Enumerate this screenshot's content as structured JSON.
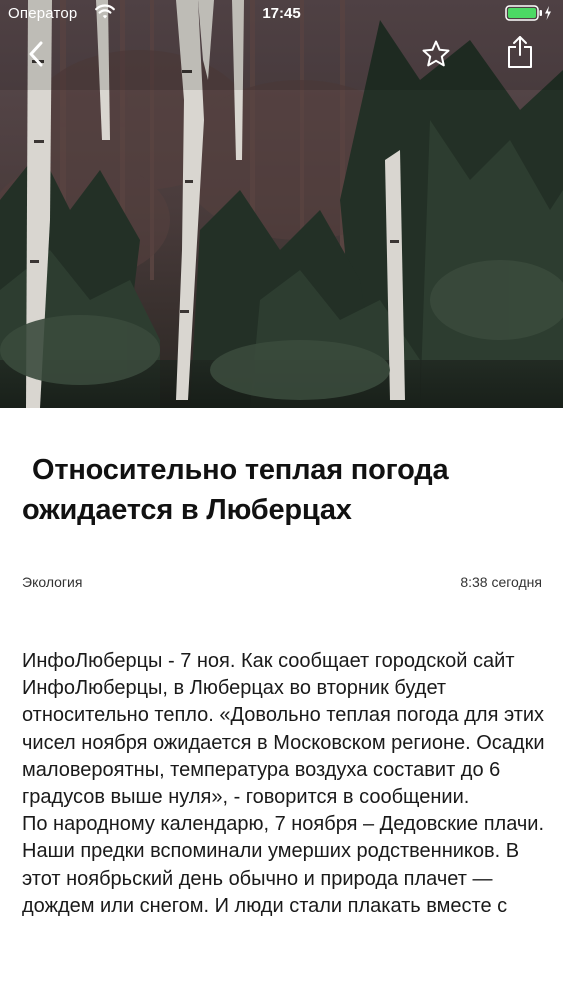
{
  "status_bar": {
    "carrier": "Оператор",
    "time": "17:45",
    "wifi_icon": "wifi-icon",
    "battery_icon": "battery-charging-icon",
    "battery_color": "#4cd964"
  },
  "navigation": {
    "back_icon": "chevron-left-icon",
    "favorite_icon": "star-outline-icon",
    "share_icon": "share-icon"
  },
  "article": {
    "title": "Относительно теплая погода ожидается в Люберцах",
    "category": "Экология",
    "time": "8:38 сегодня",
    "paragraphs": [
      "ИнфоЛюберцы - 7 ноя. Как сообщает городской сайт ИнфоЛюберцы, в Люберцах во вторник будет относительно тепло. «Довольно теплая погода для этих чисел ноября ожидается в Московском регионе. Осадки маловероятны, температура воздуха составит до 6 градусов выше нуля», - говорится в сообщении.",
      "По народному календарю, 7 ноября – Дедовские плачи. Наши предки вспоминали умерших родственников. В этот ноябрьский день обычно и природа плачет — дождем или снегом. И люди стали плакать вместе с"
    ]
  }
}
